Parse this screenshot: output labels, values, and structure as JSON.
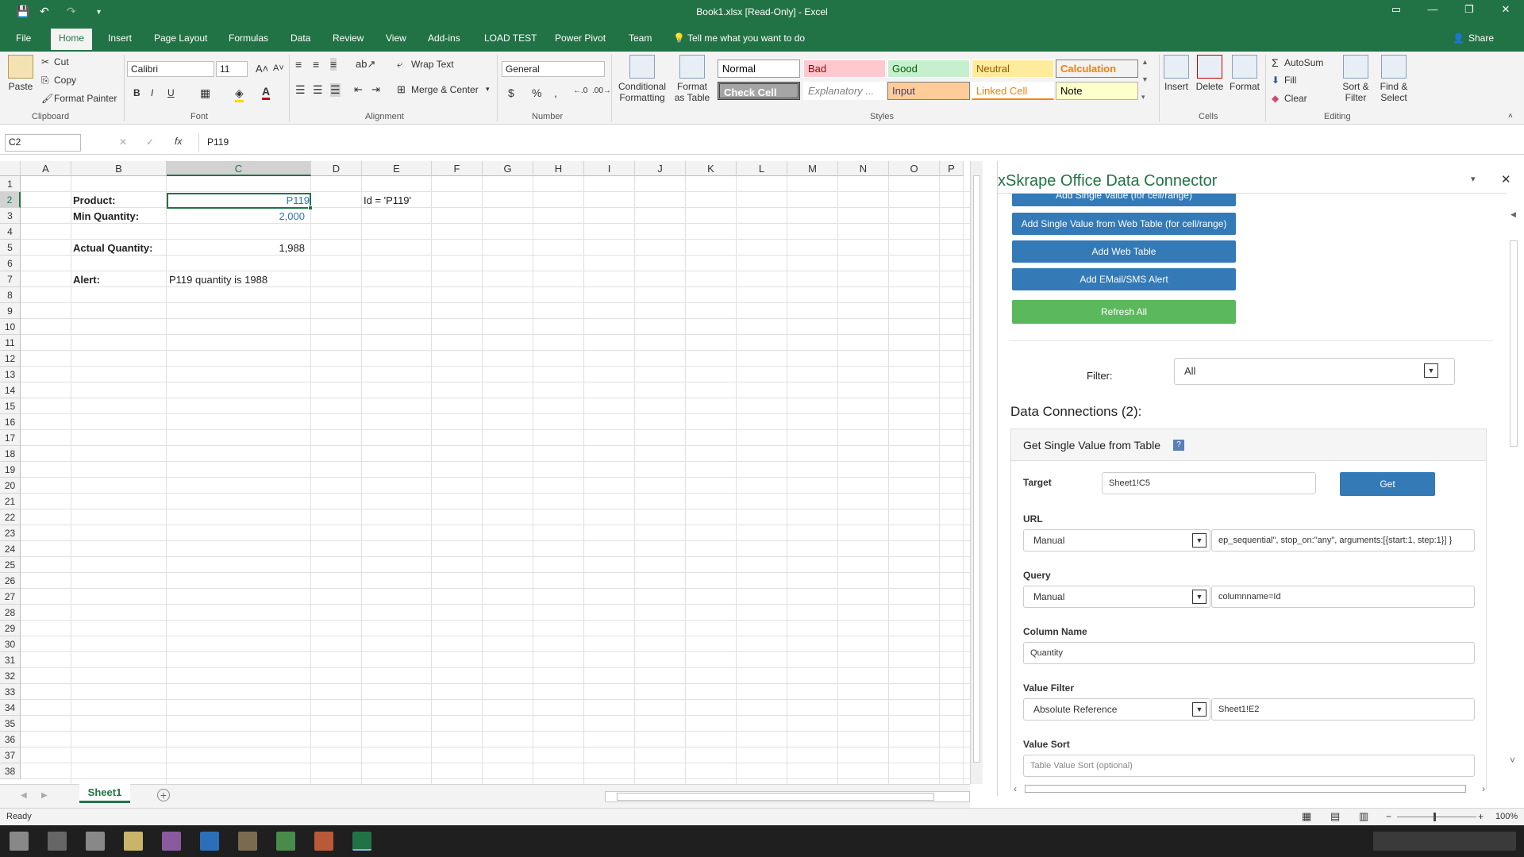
{
  "window": {
    "title": "Book1.xlsx  [Read-Only] - Excel",
    "share_label": "Share"
  },
  "tabs": [
    "File",
    "Home",
    "Insert",
    "Page Layout",
    "Formulas",
    "Data",
    "Review",
    "View",
    "Add-ins",
    "LOAD TEST",
    "Power Pivot",
    "Team"
  ],
  "tell_me": "Tell me what you want to do",
  "ribbon": {
    "clipboard": {
      "paste": "Paste",
      "cut": "Cut",
      "copy": "Copy",
      "format_painter": "Format Painter",
      "group": "Clipboard"
    },
    "font": {
      "name": "Calibri",
      "size": "11",
      "group": "Font",
      "bold": "B",
      "italic": "I",
      "underline": "U"
    },
    "alignment": {
      "wrap": "Wrap Text",
      "merge": "Merge & Center",
      "group": "Alignment"
    },
    "number": {
      "format": "General",
      "currency": "$",
      "percent": "%",
      "comma": ",",
      "group": "Number"
    },
    "styles": {
      "conditional": "Conditional Formatting",
      "format_table": "Format as Table",
      "items": [
        "Normal",
        "Bad",
        "Good",
        "Neutral",
        "Calculation",
        "Check Cell",
        "Explanatory ...",
        "Input",
        "Linked Cell",
        "Note"
      ],
      "group": "Styles"
    },
    "cells": {
      "insert": "Insert",
      "delete": "Delete",
      "format": "Format",
      "group": "Cells"
    },
    "editing": {
      "autosum": "AutoSum",
      "fill": "Fill",
      "clear": "Clear",
      "sort": "Sort & Filter",
      "find": "Find & Select",
      "group": "Editing"
    }
  },
  "formula_bar": {
    "name_box": "C2",
    "value": "P119",
    "fx": "fx"
  },
  "columns": [
    "A",
    "B",
    "C",
    "D",
    "E",
    "F",
    "G",
    "H",
    "I",
    "J",
    "K",
    "L",
    "M",
    "N",
    "O",
    "P"
  ],
  "rows": [
    "1",
    "2",
    "3",
    "4",
    "5",
    "6",
    "7",
    "8",
    "9",
    "10",
    "11",
    "12",
    "13",
    "14",
    "15",
    "16",
    "17",
    "18",
    "19",
    "20",
    "21",
    "22",
    "23",
    "24",
    "25",
    "26",
    "27",
    "28",
    "29",
    "30",
    "31",
    "32",
    "33",
    "34",
    "35",
    "36",
    "37",
    "38"
  ],
  "cells": {
    "B2": "Product:",
    "C2": "P119",
    "E2": "Id = 'P119'",
    "B3": "Min Quantity:",
    "C3": "2,000",
    "B5": "Actual Quantity:",
    "C5": "1,988",
    "B7": "Alert:",
    "C7": "P119 quantity is 1988"
  },
  "sheet_tab": "Sheet1",
  "status": {
    "ready": "Ready",
    "zoom": "100%"
  },
  "pane": {
    "title": "xSkrape Office Data Connector",
    "buttons": [
      "Add Single Value (for cell/range)",
      "Add Single Value from Web Table (for cell/range)",
      "Add Web Table",
      "Add EMail/SMS Alert"
    ],
    "refresh": "Refresh All",
    "filter_label": "Filter:",
    "filter_value": "All",
    "connections_title": "Data Connections (2):",
    "card_title": "Get Single Value from Table",
    "help": "?",
    "target_label": "Target",
    "target_value": "Sheet1!C5",
    "get_button": "Get",
    "url_label": "URL",
    "url_mode": "Manual",
    "url_value": "ep_sequential\", stop_on:\"any\", arguments:[{start:1, step:1}] }",
    "query_label": "Query",
    "query_mode": "Manual",
    "query_value": "columnname=Id",
    "column_label": "Column Name",
    "column_value": "Quantity",
    "vfilter_label": "Value Filter",
    "vfilter_mode": "Absolute Reference",
    "vfilter_value": "Sheet1!E2",
    "vsort_label": "Value Sort",
    "vsort_placeholder": "Table Value Sort (optional)"
  }
}
